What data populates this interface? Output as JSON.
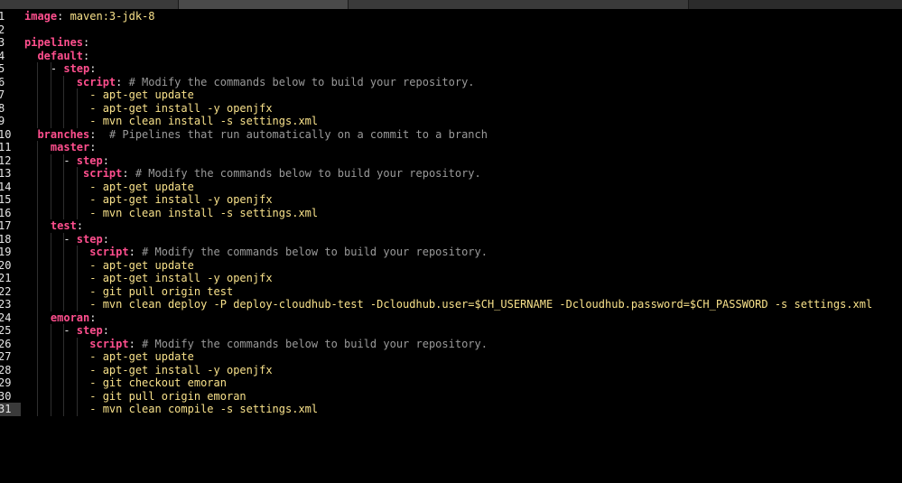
{
  "editor": {
    "lines": [
      {
        "num": "1",
        "indent": "",
        "key": "image",
        "sep": ": ",
        "value": "maven:3-jdk-8",
        "comment": ""
      },
      {
        "num": "2",
        "indent": "",
        "key": "",
        "sep": "",
        "value": "",
        "comment": ""
      },
      {
        "num": "3",
        "indent": "",
        "key": "pipelines",
        "sep": ":",
        "value": "",
        "comment": ""
      },
      {
        "num": "4",
        "indent": "  ",
        "key": "default",
        "sep": ":",
        "value": "",
        "comment": ""
      },
      {
        "num": "5",
        "indent": "    - ",
        "key": "step",
        "sep": ":",
        "value": "",
        "comment": ""
      },
      {
        "num": "6",
        "indent": "        ",
        "key": "script",
        "sep": ": ",
        "value": "",
        "comment": "# Modify the commands below to build your repository."
      },
      {
        "num": "7",
        "indent": "          ",
        "key": "",
        "sep": "",
        "value": "- apt-get update",
        "comment": ""
      },
      {
        "num": "8",
        "indent": "          ",
        "key": "",
        "sep": "",
        "value": "- apt-get install -y openjfx",
        "comment": ""
      },
      {
        "num": "9",
        "indent": "          ",
        "key": "",
        "sep": "",
        "value": "- mvn clean install -s settings.xml",
        "comment": ""
      },
      {
        "num": "10",
        "indent": "  ",
        "key": "branches",
        "sep": ":  ",
        "value": "",
        "comment": "# Pipelines that run automatically on a commit to a branch"
      },
      {
        "num": "11",
        "indent": "    ",
        "key": "master",
        "sep": ":",
        "value": "",
        "comment": ""
      },
      {
        "num": "12",
        "indent": "      - ",
        "key": "step",
        "sep": ":",
        "value": "",
        "comment": ""
      },
      {
        "num": "13",
        "indent": "         ",
        "key": "script",
        "sep": ": ",
        "value": "",
        "comment": "# Modify the commands below to build your repository."
      },
      {
        "num": "14",
        "indent": "          ",
        "key": "",
        "sep": "",
        "value": "- apt-get update",
        "comment": ""
      },
      {
        "num": "15",
        "indent": "          ",
        "key": "",
        "sep": "",
        "value": "- apt-get install -y openjfx",
        "comment": ""
      },
      {
        "num": "16",
        "indent": "          ",
        "key": "",
        "sep": "",
        "value": "- mvn clean install -s settings.xml",
        "comment": ""
      },
      {
        "num": "17",
        "indent": "    ",
        "key": "test",
        "sep": ":",
        "value": "",
        "comment": ""
      },
      {
        "num": "18",
        "indent": "      - ",
        "key": "step",
        "sep": ":",
        "value": "",
        "comment": ""
      },
      {
        "num": "19",
        "indent": "          ",
        "key": "script",
        "sep": ": ",
        "value": "",
        "comment": "# Modify the commands below to build your repository."
      },
      {
        "num": "20",
        "indent": "          ",
        "key": "",
        "sep": "",
        "value": "- apt-get update",
        "comment": ""
      },
      {
        "num": "21",
        "indent": "          ",
        "key": "",
        "sep": "",
        "value": "- apt-get install -y openjfx",
        "comment": ""
      },
      {
        "num": "22",
        "indent": "          ",
        "key": "",
        "sep": "",
        "value": "- git pull origin test",
        "comment": ""
      },
      {
        "num": "23",
        "indent": "          ",
        "key": "",
        "sep": "",
        "value": "- mvn clean deploy -P deploy-cloudhub-test -Dcloudhub.user=$CH_USERNAME -Dcloudhub.password=$CH_PASSWORD -s settings.xml",
        "comment": ""
      },
      {
        "num": "24",
        "indent": "    ",
        "key": "emoran",
        "sep": ":",
        "value": "",
        "comment": ""
      },
      {
        "num": "25",
        "indent": "      - ",
        "key": "step",
        "sep": ":",
        "value": "",
        "comment": ""
      },
      {
        "num": "26",
        "indent": "          ",
        "key": "script",
        "sep": ": ",
        "value": "",
        "comment": "# Modify the commands below to build your repository."
      },
      {
        "num": "27",
        "indent": "          ",
        "key": "",
        "sep": "",
        "value": "- apt-get update",
        "comment": ""
      },
      {
        "num": "28",
        "indent": "          ",
        "key": "",
        "sep": "",
        "value": "- apt-get install -y openjfx",
        "comment": ""
      },
      {
        "num": "29",
        "indent": "          ",
        "key": "",
        "sep": "",
        "value": "- git checkout emoran",
        "comment": ""
      },
      {
        "num": "30",
        "indent": "          ",
        "key": "",
        "sep": "",
        "value": "- git pull origin emoran",
        "comment": ""
      },
      {
        "num": "31",
        "indent": "          ",
        "key": "",
        "sep": "",
        "value": "- mvn clean compile -s settings.xml",
        "comment": ""
      }
    ],
    "current_line": "31",
    "colors": {
      "background": "#000000",
      "key": "#ff4f8e",
      "value": "#f8e18a",
      "comment": "#9a9a9a",
      "gutter": "#e6e6e6"
    }
  }
}
